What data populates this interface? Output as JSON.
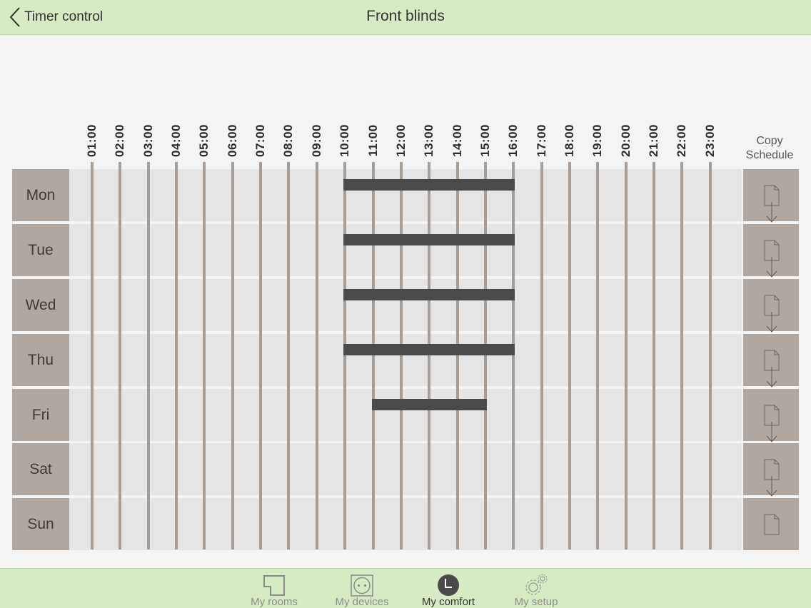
{
  "header": {
    "back_label": "Timer control",
    "title": "Front blinds"
  },
  "hours": [
    "01:00",
    "02:00",
    "03:00",
    "04:00",
    "05:00",
    "06:00",
    "07:00",
    "08:00",
    "09:00",
    "10:00",
    "11:00",
    "12:00",
    "13:00",
    "14:00",
    "15:00",
    "16:00",
    "17:00",
    "18:00",
    "19:00",
    "20:00",
    "21:00",
    "22:00",
    "23:00"
  ],
  "copy_schedule_label": "Copy\nSchedule",
  "days": [
    {
      "label": "Mon",
      "schedule": {
        "start": "10:00",
        "end": "16:00"
      }
    },
    {
      "label": "Tue",
      "schedule": {
        "start": "10:00",
        "end": "16:00"
      }
    },
    {
      "label": "Wed",
      "schedule": {
        "start": "10:00",
        "end": "16:00"
      }
    },
    {
      "label": "Thu",
      "schedule": {
        "start": "10:00",
        "end": "16:00"
      }
    },
    {
      "label": "Fri",
      "schedule": {
        "start": "11:00",
        "end": "15:00"
      }
    },
    {
      "label": "Sat",
      "schedule": null
    },
    {
      "label": "Sun",
      "schedule": null
    }
  ],
  "tabs": [
    {
      "label": "My rooms",
      "icon": "rooms-icon",
      "active": false
    },
    {
      "label": "My devices",
      "icon": "socket-icon",
      "active": false
    },
    {
      "label": "My comfort",
      "icon": "clock-icon",
      "active": true
    },
    {
      "label": "My setup",
      "icon": "gears-icon",
      "active": false
    }
  ],
  "colors": {
    "bar_green": "#d6ebc3",
    "day_cell": "#b0a8a0",
    "timer_bar": "#4a4a4a",
    "grid_line": "#a59d96"
  }
}
